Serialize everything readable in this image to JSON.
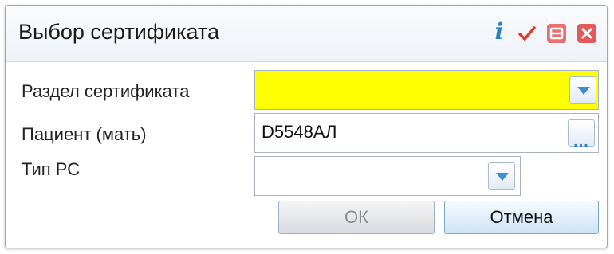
{
  "dialog": {
    "title": "Выбор сертификата",
    "toolbar_icons": [
      "info-icon",
      "check-icon",
      "minimize-icon",
      "close-icon"
    ],
    "info_glyph": "i"
  },
  "form": {
    "section": {
      "label": "Раздел сертификата",
      "value": "",
      "highlight_color": "#ffff00"
    },
    "patient": {
      "label": "Пациент (мать)",
      "value": "D5548АЛ",
      "button_text": "..."
    },
    "type": {
      "label": "Тип РС",
      "value": ""
    }
  },
  "buttons": {
    "ok": "ОК",
    "cancel": "Отмена"
  },
  "colors": {
    "accent": "#2d7cc9",
    "close": "#e05a5a",
    "check": "#e03a2a"
  }
}
